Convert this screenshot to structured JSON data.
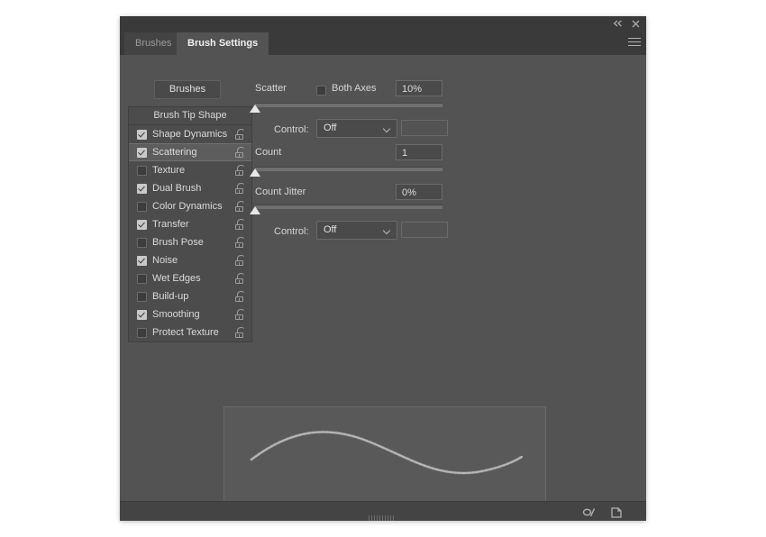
{
  "window": {
    "collapse_icon": "double-chevron-left-icon",
    "close_icon": "close-icon",
    "menu_icon": "hamburger-menu-icon"
  },
  "tabs": [
    {
      "label": "Brushes",
      "active": false
    },
    {
      "label": "Brush Settings",
      "active": true
    }
  ],
  "toolbar": {
    "brushes_button": "Brushes"
  },
  "options_panel": {
    "header": "Brush Tip Shape",
    "items": [
      {
        "label": "Shape Dynamics",
        "checked": true,
        "selected": false,
        "lock": "unlock-icon"
      },
      {
        "label": "Scattering",
        "checked": true,
        "selected": true,
        "lock": "unlock-icon"
      },
      {
        "label": "Texture",
        "checked": false,
        "selected": false,
        "lock": "unlock-icon"
      },
      {
        "label": "Dual Brush",
        "checked": true,
        "selected": false,
        "lock": "unlock-icon"
      },
      {
        "label": "Color Dynamics",
        "checked": false,
        "selected": false,
        "lock": "unlock-icon"
      },
      {
        "label": "Transfer",
        "checked": true,
        "selected": false,
        "lock": "unlock-icon"
      },
      {
        "label": "Brush Pose",
        "checked": false,
        "selected": false,
        "lock": "unlock-icon"
      },
      {
        "label": "Noise",
        "checked": true,
        "selected": false,
        "lock": "unlock-icon"
      },
      {
        "label": "Wet Edges",
        "checked": false,
        "selected": false,
        "lock": "unlock-icon"
      },
      {
        "label": "Build-up",
        "checked": false,
        "selected": false,
        "lock": "unlock-icon"
      },
      {
        "label": "Smoothing",
        "checked": true,
        "selected": false,
        "lock": "unlock-icon"
      },
      {
        "label": "Protect Texture",
        "checked": false,
        "selected": false,
        "lock": "unlock-icon"
      }
    ]
  },
  "scattering": {
    "scatter_label": "Scatter",
    "scatter_value": "10%",
    "scatter_slider_percent": 0,
    "both_axes_label": "Both Axes",
    "both_axes_checked": false,
    "scatter_control_label": "Control:",
    "scatter_control_value": "Off",
    "scatter_control_extra": "",
    "count_label": "Count",
    "count_value": "1",
    "count_slider_percent": 0,
    "count_jitter_label": "Count Jitter",
    "count_jitter_value": "0%",
    "count_jitter_slider_percent": 0,
    "jitter_control_label": "Control:",
    "jitter_control_value": "Off",
    "jitter_control_extra": ""
  },
  "preview": {
    "name": "brush-stroke-preview"
  },
  "footer": {
    "toggle_brush_preview_icon": "brush-preview-toggle-icon",
    "new_brush_icon": "new-brush-icon",
    "resize_grip_icon": "resize-grip-icon"
  },
  "colors": {
    "panel_bg": "#535353",
    "chrome_bg": "#3a3a3a",
    "active_tab": "#535353",
    "text": "#d6d6d6",
    "accent": "#e8e8e8"
  }
}
